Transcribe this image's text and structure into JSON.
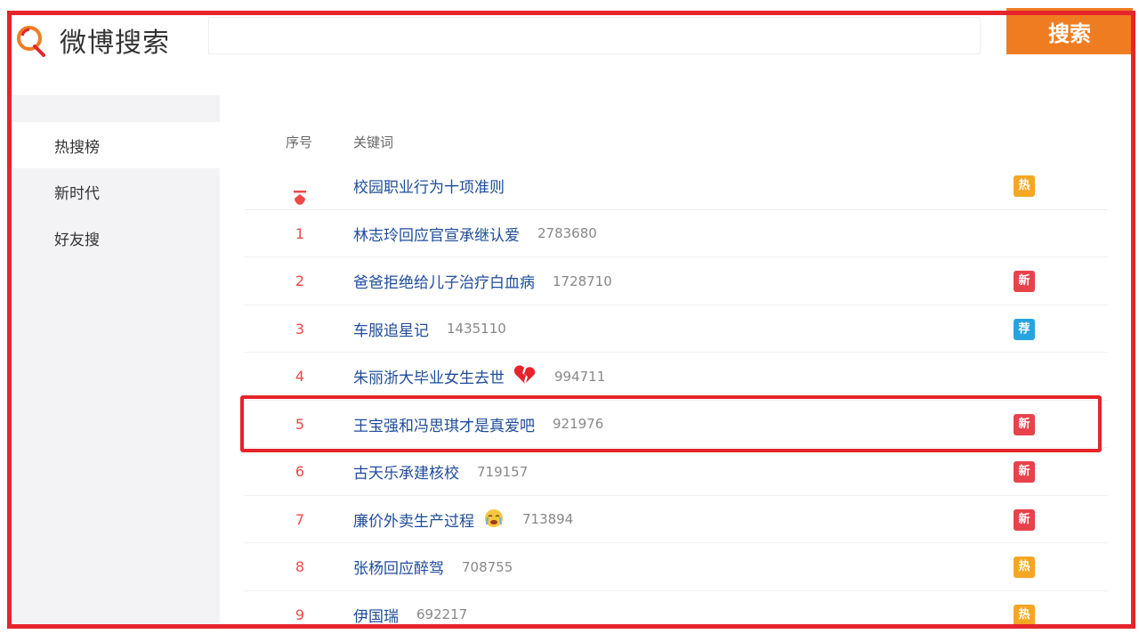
{
  "header": {
    "logo_text": "微博搜索",
    "search_placeholder": "",
    "search_button": "搜索"
  },
  "sidebar": {
    "items": [
      {
        "label": "热搜榜",
        "active": true
      },
      {
        "label": "新时代",
        "active": false
      },
      {
        "label": "好友搜",
        "active": false
      }
    ]
  },
  "table": {
    "col_rank": "序号",
    "col_keyword": "关键词",
    "rows": [
      {
        "rank": "",
        "pinned": true,
        "keyword": "校园职业行为十项准则",
        "count": "",
        "emoji": "",
        "badge": "热",
        "badge_color": "#f5a623"
      },
      {
        "rank": "1",
        "keyword": "林志玲回应官宣承继认爱",
        "count": "2783680",
        "emoji": "",
        "badge": "",
        "badge_color": ""
      },
      {
        "rank": "2",
        "keyword": "爸爸拒绝给儿子治疗白血病",
        "count": "1728710",
        "emoji": "",
        "badge": "新",
        "badge_color": "#e8424a"
      },
      {
        "rank": "3",
        "keyword": "车服追星记",
        "count": "1435110",
        "emoji": "",
        "badge": "荐",
        "badge_color": "#27a3e0"
      },
      {
        "rank": "4",
        "keyword": "朱丽浙大毕业女生去世",
        "count": "994711",
        "emoji": "💔",
        "badge": "",
        "badge_color": ""
      },
      {
        "rank": "5",
        "keyword": "王宝强和冯思琪才是真爱吧",
        "count": "921976",
        "emoji": "",
        "badge": "新",
        "badge_color": "#e8424a"
      },
      {
        "rank": "6",
        "keyword": "古天乐承建核校",
        "count": "719157",
        "emoji": "",
        "badge": "新",
        "badge_color": "#e8424a"
      },
      {
        "rank": "7",
        "keyword": "廉价外卖生产过程",
        "count": "713894",
        "emoji": "😭",
        "badge": "新",
        "badge_color": "#e8424a"
      },
      {
        "rank": "8",
        "keyword": "张杨回应醉驾",
        "count": "708755",
        "emoji": "",
        "badge": "热",
        "badge_color": "#f5a623"
      },
      {
        "rank": "9",
        "keyword": "伊国瑞",
        "count": "692217",
        "emoji": "",
        "badge": "热",
        "badge_color": "#f5a623"
      }
    ]
  },
  "colors": {
    "accent": "#f07c22",
    "frame_red": "#e5242b",
    "link_blue": "#1e4c9a",
    "rank_red": "#f04848"
  }
}
